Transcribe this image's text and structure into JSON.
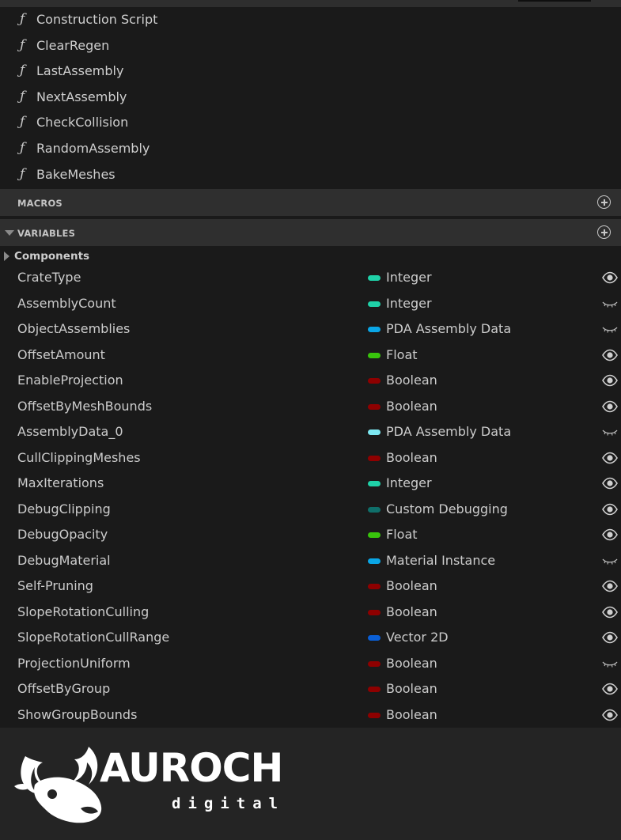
{
  "functions": [
    {
      "label": "Construction Script",
      "icon": "construction-script-icon"
    },
    {
      "label": "ClearRegen",
      "icon": "function-icon"
    },
    {
      "label": "LastAssembly",
      "icon": "function-icon"
    },
    {
      "label": "NextAssembly",
      "icon": "function-icon"
    },
    {
      "label": "CheckCollision",
      "icon": "function-icon"
    },
    {
      "label": "RandomAssembly",
      "icon": "function-icon"
    },
    {
      "label": "BakeMeshes",
      "icon": "function-icon"
    }
  ],
  "function_glyph": "ƒ",
  "macros": {
    "title": "MACROS"
  },
  "variables": {
    "title": "VARIABLES",
    "category": "Components",
    "items": [
      {
        "name": "CrateType",
        "type": "Integer",
        "color": "#1fd1a8",
        "visible": true
      },
      {
        "name": "AssemblyCount",
        "type": "Integer",
        "color": "#1fd1a8",
        "visible": false
      },
      {
        "name": "ObjectAssemblies",
        "type": "PDA Assembly Data",
        "color": "#0aa6e6",
        "visible": false
      },
      {
        "name": "OffsetAmount",
        "type": "Float",
        "color": "#38c40c",
        "visible": true
      },
      {
        "name": "EnableProjection",
        "type": "Boolean",
        "color": "#8e0000",
        "visible": true
      },
      {
        "name": "OffsetByMeshBounds",
        "type": "Boolean",
        "color": "#8e0000",
        "visible": true
      },
      {
        "name": "AssemblyData_0",
        "type": "PDA Assembly Data",
        "color": "#7de8f2",
        "visible": false
      },
      {
        "name": "CullClippingMeshes",
        "type": "Boolean",
        "color": "#8e0000",
        "visible": true
      },
      {
        "name": "MaxIterations",
        "type": "Integer",
        "color": "#1fd1a8",
        "visible": true
      },
      {
        "name": "DebugClipping",
        "type": "Custom Debugging",
        "color": "#0f6f6a",
        "visible": true
      },
      {
        "name": "DebugOpacity",
        "type": "Float",
        "color": "#38c40c",
        "visible": true
      },
      {
        "name": "DebugMaterial",
        "type": "Material Instance",
        "color": "#0aa6e6",
        "visible": false
      },
      {
        "name": "Self-Pruning",
        "type": "Boolean",
        "color": "#8e0000",
        "visible": true
      },
      {
        "name": "SlopeRotationCulling",
        "type": "Boolean",
        "color": "#8e0000",
        "visible": true
      },
      {
        "name": "SlopeRotationCullRange",
        "type": "Vector 2D",
        "color": "#0a5fd6",
        "visible": true
      },
      {
        "name": "ProjectionUniform",
        "type": "Boolean",
        "color": "#8e0000",
        "visible": false
      },
      {
        "name": "OffsetByGroup",
        "type": "Boolean",
        "color": "#8e0000",
        "visible": true
      },
      {
        "name": "ShowGroupBounds",
        "type": "Boolean",
        "color": "#8e0000",
        "visible": true
      }
    ]
  },
  "logo": {
    "name": "AUROCH",
    "sub": "digital",
    "icon": "bull-head-logo"
  }
}
